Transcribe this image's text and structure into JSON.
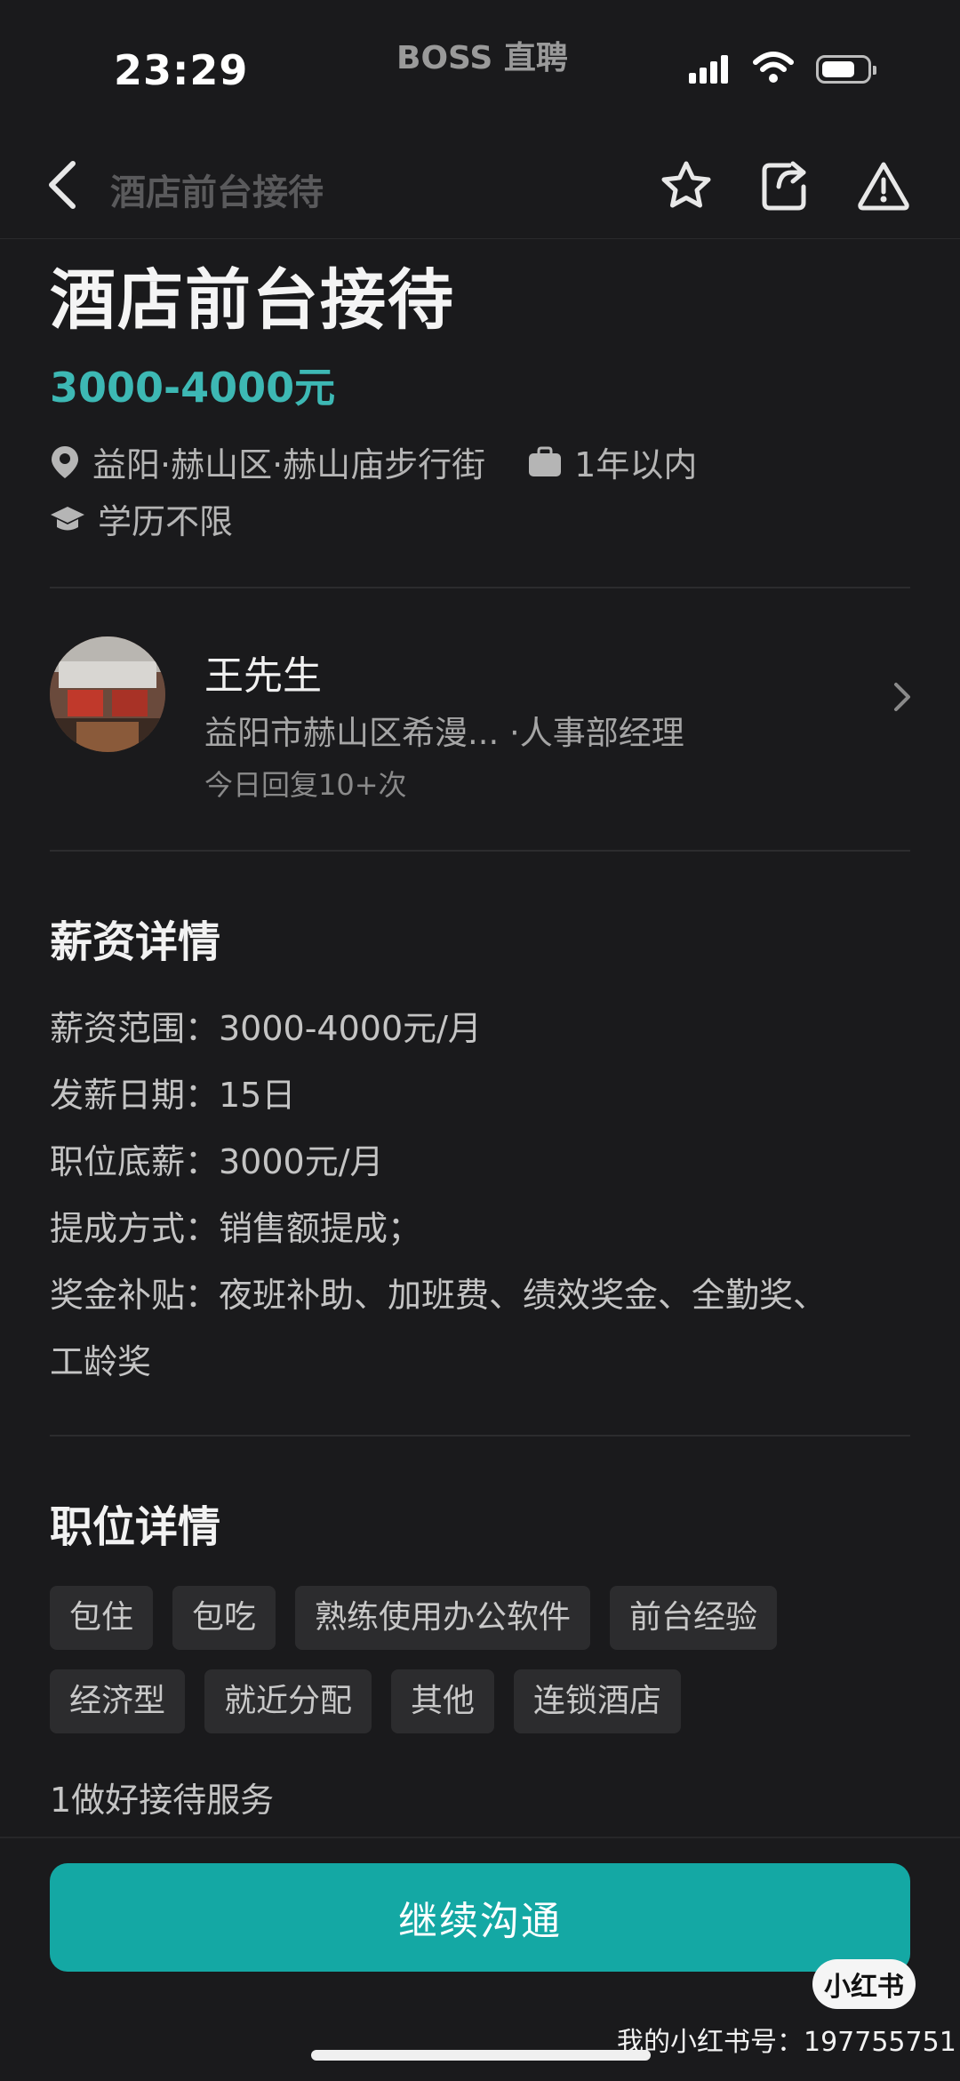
{
  "status_bar": {
    "time": "23:29",
    "brand": "BOSS 直聘",
    "icons": [
      "signal-icon",
      "wifi-icon",
      "battery-icon"
    ]
  },
  "nav": {
    "title": "酒店前台接待",
    "icons": [
      "back-icon",
      "star-icon",
      "share-icon",
      "report-icon"
    ]
  },
  "job": {
    "title": "酒店前台接待",
    "salary": "3000-4000元",
    "location": "益阳·赫山区·赫山庙步行街",
    "experience": "1年以内",
    "education": "学历不限"
  },
  "recruiter": {
    "name": "王先生",
    "company_role": "益阳市赫山区希漫... ·人事部经理",
    "reply_stat": "今日回复10+次"
  },
  "salary_details": {
    "title": "薪资详情",
    "lines": [
      "薪资范围：3000-4000元/月",
      "发薪日期：15日",
      "职位底薪：3000元/月",
      "提成方式：销售额提成；",
      "奖金补贴：夜班补助、加班费、绩效奖金、全勤奖、",
      "工龄奖"
    ]
  },
  "job_details": {
    "title": "职位详情",
    "tags": [
      "包住",
      "包吃",
      "熟练使用办公软件",
      "前台经验",
      "经济型",
      "就近分配",
      "其他",
      "连锁酒店"
    ],
    "description": "1做好接待服务"
  },
  "actions": {
    "primary_label": "继续沟通"
  },
  "watermark": {
    "badge": "小红书",
    "account": "我的小红书号：197755751"
  },
  "colors": {
    "background": "#1a1a1c",
    "accent": "#14a8a4",
    "salary_text": "#3db8b4"
  }
}
